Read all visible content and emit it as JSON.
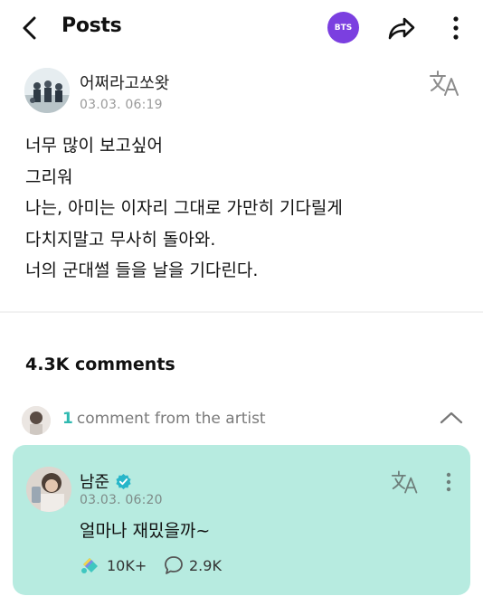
{
  "header": {
    "title": "Posts",
    "badge_label": "BTS",
    "badge_color": "#7b3fe0",
    "icons": [
      "back-arrow-icon",
      "share-icon",
      "more-vertical-icon"
    ]
  },
  "post": {
    "author": "어쩌라고쏘왓",
    "timestamp": "03.03. 06:19",
    "lines": [
      "너무 많이 보고싶어",
      "그리워",
      "나는, 아미는 이자리 그대로 가만히 기다릴게",
      "다치지말고 무사히 돌아와.",
      "너의 군대썰 들을 날을 기다린다."
    ],
    "translate_icon": "translate-icon"
  },
  "comments": {
    "count_label": "4.3K comments",
    "artist_count": "1",
    "artist_label": "comment from the artist",
    "accent_color": "#2fb9b0"
  },
  "artist_comment": {
    "name": "남준",
    "timestamp": "03.03. 06:20",
    "text": "얼마나 재밌을까~",
    "likes": "10K+",
    "replies": "2.9K",
    "card_color": "#b7ebe0"
  }
}
